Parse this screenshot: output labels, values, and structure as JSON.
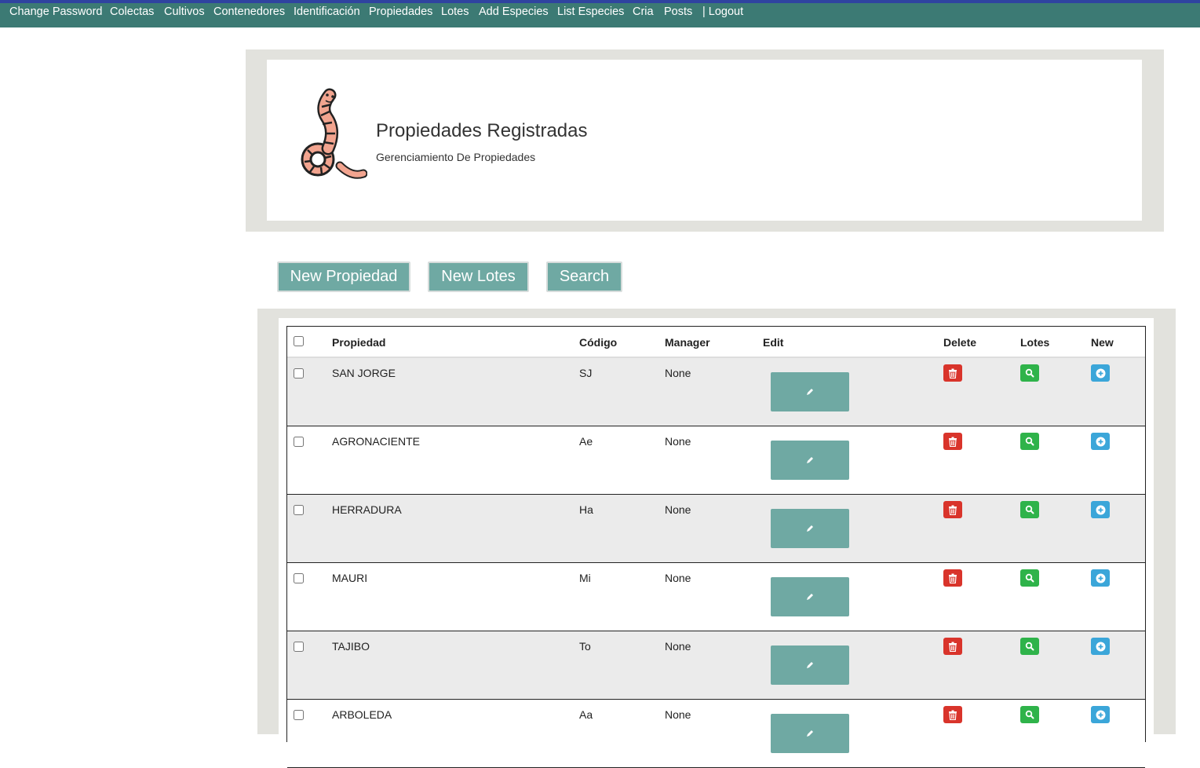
{
  "nav": {
    "items": [
      {
        "label": "Change Password"
      },
      {
        "label": "Colectas"
      },
      {
        "label": "Cultivos"
      },
      {
        "label": "Contenedores"
      },
      {
        "label": "Identificación"
      },
      {
        "label": "Propiedades"
      },
      {
        "label": "Lotes"
      },
      {
        "label": "Add Especies"
      },
      {
        "label": "List Especies"
      },
      {
        "label": "Cria"
      },
      {
        "label": "Posts"
      },
      {
        "label": "| Logout"
      }
    ]
  },
  "header": {
    "logo_icon": "worm-icon",
    "title": "Propiedades Registradas",
    "subtitle": "Gerenciamiento De Propiedades"
  },
  "actions": {
    "new_propiedad": "New Propiedad",
    "new_lotes": "New Lotes",
    "search": "Search"
  },
  "table": {
    "columns": {
      "propiedad": "Propiedad",
      "codigo": "Código",
      "manager": "Manager",
      "edit": "Edit",
      "delete": "Delete",
      "lotes": "Lotes",
      "new": "New"
    },
    "rows": [
      {
        "propiedad": "SAN JORGE",
        "codigo": "SJ",
        "manager": "None"
      },
      {
        "propiedad": "AGRONACIENTE",
        "codigo": "Ae",
        "manager": "None"
      },
      {
        "propiedad": "HERRADURA",
        "codigo": "Ha",
        "manager": "None"
      },
      {
        "propiedad": "MAURI",
        "codigo": "Mi",
        "manager": "None"
      },
      {
        "propiedad": "TAJIBO",
        "codigo": "To",
        "manager": "None"
      },
      {
        "propiedad": "ARBOLEDA",
        "codigo": "Aa",
        "manager": "None"
      }
    ]
  },
  "colors": {
    "navbar": "#3c7a74",
    "accent": "#6fa9a3",
    "delete": "#d9342b",
    "lotes": "#2fb34a",
    "new": "#3ba6d9"
  }
}
